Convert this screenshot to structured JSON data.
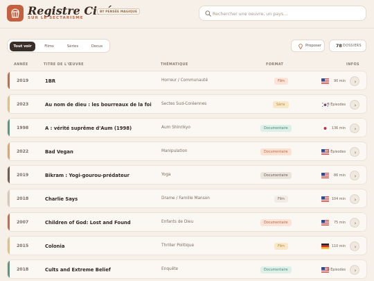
{
  "header": {
    "title": "Registre Ciné",
    "brand_badge": "BY PENSÉE MAGIQUE",
    "subtitle": "SUR LE SECTARISME",
    "search_placeholder": "Rechercher une oeuvre, un pays..."
  },
  "tabs": [
    {
      "label": "Tout voir",
      "active": true
    },
    {
      "label": "Films",
      "active": false
    },
    {
      "label": "Séries",
      "active": false
    },
    {
      "label": "Docus",
      "active": false
    }
  ],
  "actions": {
    "propose_label": "Proposer",
    "count_value": "78",
    "count_label": "DOSSIERS"
  },
  "table": {
    "headers": {
      "year": "ANNÉE",
      "title": "TITRE DE L'ŒUVRE",
      "theme": "THÉMATIQUE",
      "format": "FORMAT",
      "info": "INFOS"
    },
    "rows": [
      {
        "year": "2019",
        "title": "1BR",
        "theme": "Horreur / Communauté",
        "format": "Film",
        "flag": "us",
        "duration": "90 min"
      },
      {
        "year": "2023",
        "title": "Au nom de dieu : les bourreaux de la foi",
        "theme": "Sectes Sud-Coréennes",
        "format": "Série",
        "flag": "kr",
        "duration": "8 Épisodes"
      },
      {
        "year": "1998",
        "title": "A : vérité suprême d'Aum (1998)",
        "theme": "Aum Shinrikyo",
        "format": "Documentaire",
        "flag": "jp",
        "duration": "136 min"
      },
      {
        "year": "2022",
        "title": "Bad Vegan",
        "theme": "Manipulation",
        "format": "Documentaire",
        "flag": "us",
        "duration": "4 Épisodes"
      },
      {
        "year": "2019",
        "title": "Bikram : Yogi-gourou-prédateur",
        "theme": "Yoga",
        "format": "Documentaire",
        "flag": "us",
        "duration": "86 min"
      },
      {
        "year": "2018",
        "title": "Charlie Says",
        "theme": "Drame / Famille Manson",
        "format": "Film",
        "flag": "us",
        "duration": "104 min"
      },
      {
        "year": "2007",
        "title": "Children of God: Lost and Found",
        "theme": "Enfants de Dieu",
        "format": "Documentaire",
        "flag": "us",
        "duration": "75 min"
      },
      {
        "year": "2015",
        "title": "Colonia",
        "theme": "Thriller Politique",
        "format": "Film",
        "flag": "de",
        "duration": "110 min"
      },
      {
        "year": "2018",
        "title": "Cults and Extreme Belief",
        "theme": "Enquête",
        "format": "Documentaire",
        "flag": "us",
        "duration": "9 Épisodes"
      }
    ]
  },
  "styles": {
    "accent_colors": [
      "#c96c4c",
      "#e2c275",
      "#4f9e89",
      "#e6a26b",
      "#7a5a45",
      "#d8c7b5",
      "#c96c4c",
      "#e2c275",
      "#4f9e89"
    ],
    "format_styles": [
      {
        "bg": "#fbe3d8",
        "fg": "#c0603f"
      },
      {
        "bg": "#f8e8c8",
        "fg": "#b58a3c"
      },
      {
        "bg": "#dcefe8",
        "fg": "#3f8a74"
      },
      {
        "bg": "#fbe1d2",
        "fg": "#c46a44"
      },
      {
        "bg": "#ebe4dc",
        "fg": "#6b5a4e"
      },
      {
        "bg": "#f0ebe5",
        "fg": "#7a6a5e"
      },
      {
        "bg": "#fbe3d8",
        "fg": "#c0603f"
      },
      {
        "bg": "#f8e8c8",
        "fg": "#b58a3c"
      },
      {
        "bg": "#dcefe8",
        "fg": "#3f8a74"
      }
    ],
    "brand_color": "#c4603f"
  }
}
